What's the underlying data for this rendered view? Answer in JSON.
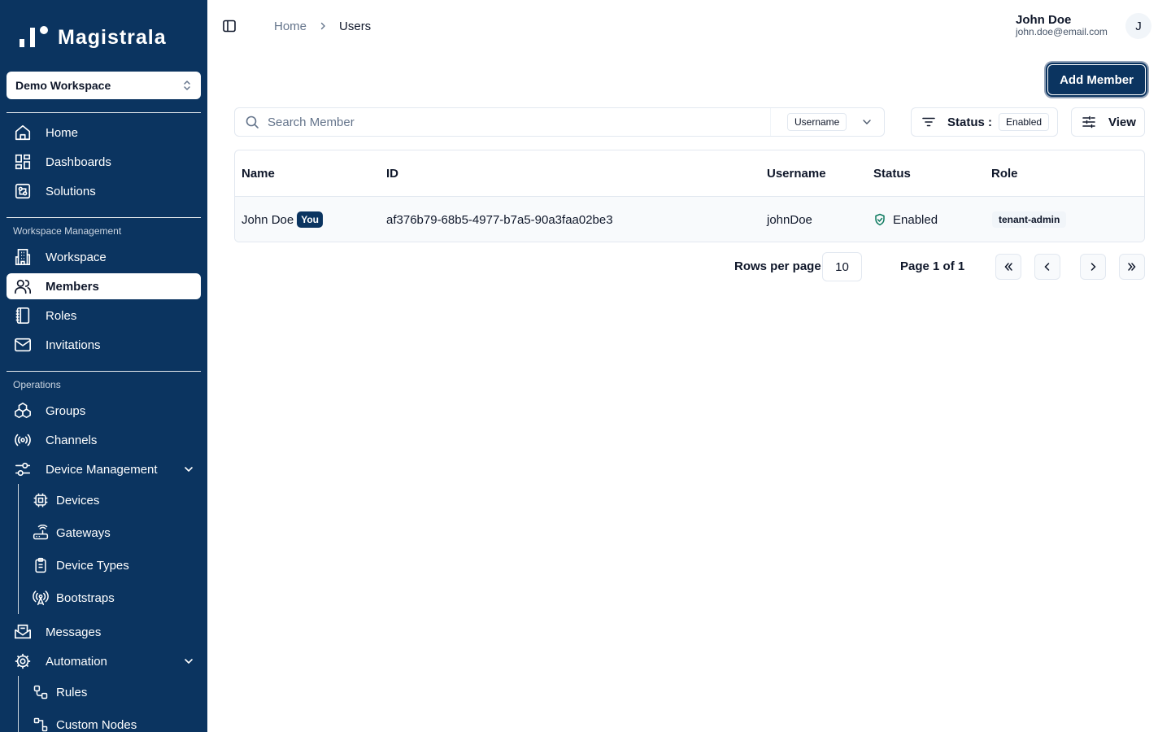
{
  "app": {
    "name": "Magistrala"
  },
  "workspace_select": {
    "value": "Demo Workspace"
  },
  "sidebar": {
    "main_items": [
      {
        "label": "Home",
        "icon": "home-icon"
      },
      {
        "label": "Dashboards",
        "icon": "dashboard-icon"
      },
      {
        "label": "Solutions",
        "icon": "solutions-icon"
      }
    ],
    "workspace_section": {
      "title": "Workspace Management",
      "items": [
        {
          "label": "Workspace",
          "icon": "building-icon"
        },
        {
          "label": "Members",
          "icon": "users-icon",
          "active": true
        },
        {
          "label": "Roles",
          "icon": "notebook-icon"
        },
        {
          "label": "Invitations",
          "icon": "mail-icon"
        }
      ]
    },
    "operations_section": {
      "title": "Operations",
      "items": [
        {
          "label": "Groups",
          "icon": "groups-icon"
        },
        {
          "label": "Channels",
          "icon": "radio-icon"
        },
        {
          "label": "Device Management",
          "icon": "settings-sliders-icon",
          "expanded": true
        }
      ],
      "device_management_children": [
        {
          "label": "Devices",
          "icon": "cpu-icon"
        },
        {
          "label": "Gateways",
          "icon": "router-icon"
        },
        {
          "label": "Device Types",
          "icon": "clipboard-icon"
        },
        {
          "label": "Bootstraps",
          "icon": "antenna-icon"
        }
      ],
      "more_items": [
        {
          "label": "Messages",
          "icon": "mail-open-icon"
        },
        {
          "label": "Automation",
          "icon": "cog-icon",
          "expanded": true
        }
      ],
      "automation_children": [
        {
          "label": "Rules",
          "icon": "workflow-icon"
        },
        {
          "label": "Custom Nodes",
          "icon": "nodes-icon"
        }
      ]
    }
  },
  "header": {
    "breadcrumb": {
      "home": "Home",
      "current": "Users"
    },
    "user": {
      "name": "John Doe",
      "email": "john.doe@email.com",
      "initial": "J"
    }
  },
  "toolbar": {
    "add_member_label": "Add Member",
    "search_placeholder": "Search Member",
    "search_field": "Username",
    "status_label": "Status :",
    "status_value": "Enabled",
    "view_label": "View"
  },
  "table": {
    "columns": [
      "Name",
      "ID",
      "Username",
      "Status",
      "Role"
    ],
    "rows": [
      {
        "name": "John Doe",
        "badge": "You",
        "id": "af376b79-68b5-4977-b7a5-90a3faa02be3",
        "username": "johnDoe",
        "status": "Enabled",
        "role": "tenant-admin"
      }
    ]
  },
  "pagination": {
    "rows_per_page_label": "Rows per page",
    "rows_per_page": "10",
    "page_label": "Page 1 of 1"
  },
  "colors": {
    "sidebar": "#0b3460",
    "accent": "#0b3460",
    "success": "#0d7a5f"
  }
}
